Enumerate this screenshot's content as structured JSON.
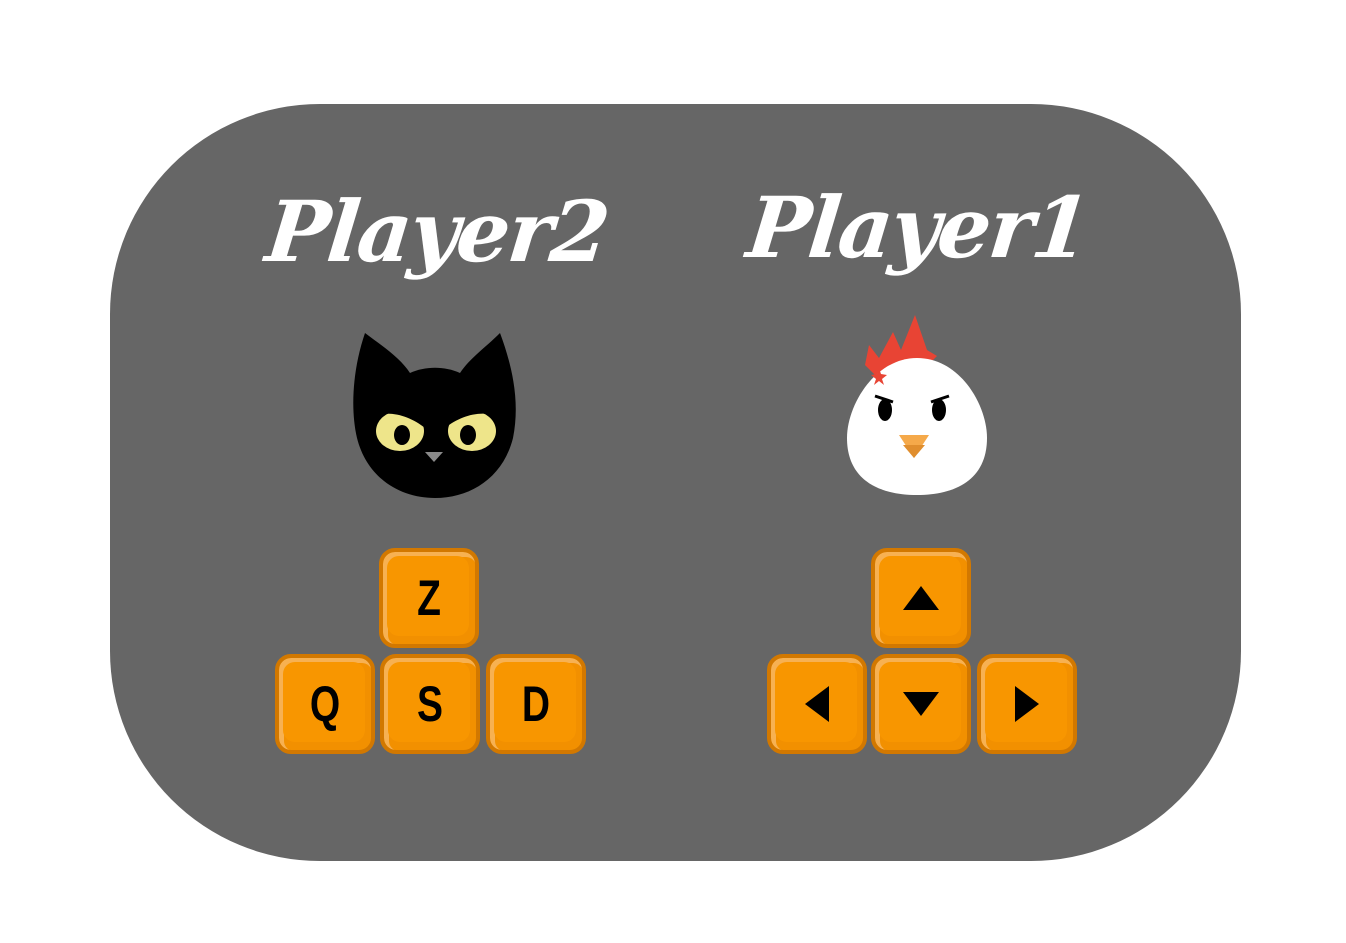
{
  "players": {
    "player2": {
      "title": "Player2",
      "avatar_icon": "cat-face-icon",
      "keys": {
        "up": "Z",
        "left": "Q",
        "down": "S",
        "right": "D"
      }
    },
    "player1": {
      "title": "Player1",
      "avatar_icon": "chicken-face-icon",
      "keys": {
        "up": "up-arrow-icon",
        "left": "left-arrow-icon",
        "down": "down-arrow-icon",
        "right": "right-arrow-icon"
      }
    }
  },
  "colors": {
    "background": "#ffffff",
    "panel": "#666666",
    "key_fill": "#f89600",
    "key_border": "#d27800",
    "cat_eye": "#eee58a",
    "chicken_comb": "#e84434",
    "chicken_beak": "#f5a94a"
  }
}
